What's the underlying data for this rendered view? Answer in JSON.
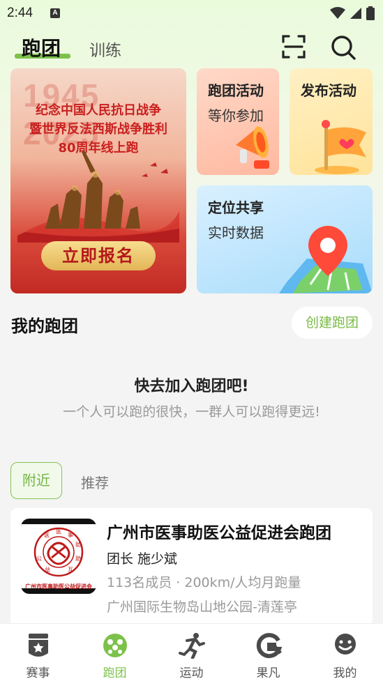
{
  "status_bar": {
    "time": "2:44",
    "notification_badge": "A"
  },
  "header": {
    "active_tab": "跑团",
    "inactive_tab": "训练",
    "scan_icon": "scan-icon",
    "search_icon": "search-icon",
    "accent_color": "#7cc24a"
  },
  "banner": {
    "year_text": "1945 2025",
    "line1": "纪念中国人民抗日战争",
    "line2": "暨世界反法西斯战争胜利",
    "line3": "80周年线上跑",
    "button": "立即报名"
  },
  "cards": {
    "activity": {
      "title": "跑团活动",
      "subtitle": "等你参加"
    },
    "publish": {
      "title": "发布活动"
    },
    "location": {
      "title": "定位共享",
      "subtitle": "实时数据"
    }
  },
  "my_groups": {
    "title": "我的跑团",
    "create_button": "创建跑团",
    "empty_title": "快去加入跑团吧!",
    "empty_subtitle": "一个人可以跑的很快，一群人可以跑得更远!"
  },
  "filter_tabs": {
    "active": "附近",
    "inactive": "推荐"
  },
  "group": {
    "name": "广州市医事助医公益促进会跑团",
    "leader": "团长 施少斌",
    "stats": "113名成员 · 200km/人均月跑量",
    "location": "广州国际生物岛山地公园-清莲亭",
    "logo_text": "广州市医事助医公益促进会",
    "logo_ring_chars": [
      "医",
      "事",
      "助",
      "医",
      "公",
      "益",
      "互",
      "助"
    ]
  },
  "bottom_nav": [
    {
      "label": "赛事",
      "icon": "medal-icon",
      "active": false
    },
    {
      "label": "跑团",
      "icon": "group-icon",
      "active": true
    },
    {
      "label": "运动",
      "icon": "runner-icon",
      "active": false
    },
    {
      "label": "果凡",
      "icon": "brand-g-icon",
      "active": false
    },
    {
      "label": "我的",
      "icon": "smiley-icon",
      "active": false
    }
  ]
}
